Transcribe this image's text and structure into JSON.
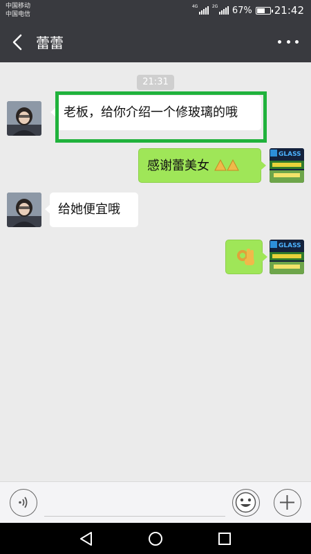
{
  "status_bar": {
    "carrier_1": "中国移动",
    "carrier_2": "中国电信",
    "net_1": "4G",
    "net_2": "2G",
    "battery": "67%",
    "battery_level": 0.67,
    "time": "21:42"
  },
  "header": {
    "title": "蕾蕾"
  },
  "chat": {
    "timestamp": "21:31",
    "messages": [
      {
        "side": "left",
        "text": "老板，给你介绍一个修玻璃的哦",
        "highlighted": true
      },
      {
        "side": "right",
        "text": "感谢蕾美女",
        "emoji": "pray-emoji-x2"
      },
      {
        "side": "left",
        "text": "给她便宜哦"
      },
      {
        "side": "right",
        "text": "",
        "emoji": "ok-hand-emoji"
      }
    ]
  },
  "avatars": {
    "other_logo_text": "GLASS"
  },
  "composer": {
    "voice_icon": "voice-icon",
    "emoji_icon": "smiley-icon",
    "plus_icon": "plus-icon"
  },
  "colors": {
    "titlebar": "#393a3f",
    "chat_bg": "#ebebeb",
    "outgoing_bubble": "#9fe658",
    "highlight_border": "#20b23c"
  }
}
